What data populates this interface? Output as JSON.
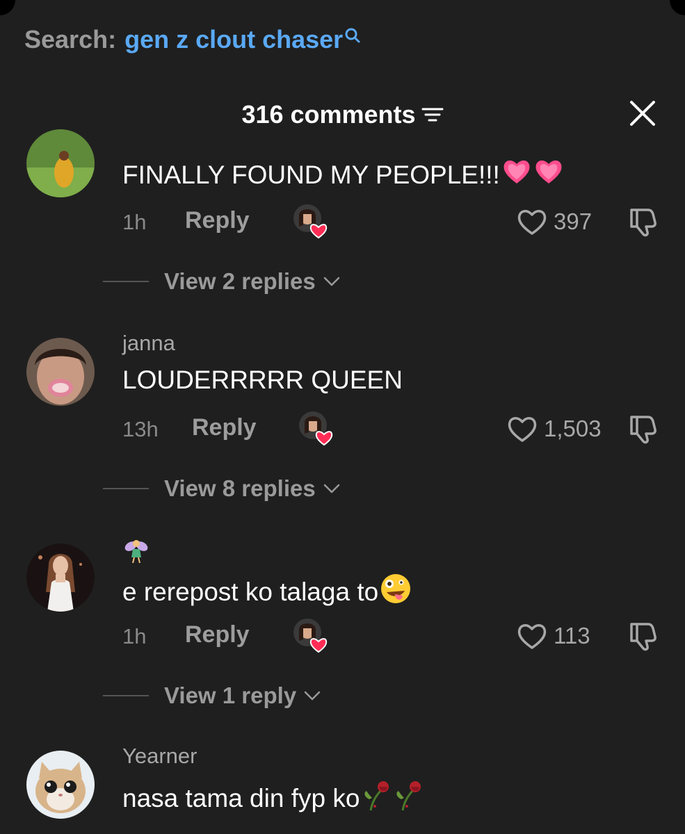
{
  "search": {
    "label": "Search:",
    "query": "gen z clout chaser"
  },
  "header": {
    "count_label": "316 comments"
  },
  "comments": [
    {
      "username": "",
      "text": "FINALLY FOUND MY PEOPLE!!!",
      "time": "1h",
      "reply_label": "Reply",
      "likes": "397",
      "view_replies": "View 2 replies"
    },
    {
      "username": "janna",
      "text": "LOUDERRRRR QUEEN",
      "time": "13h",
      "reply_label": "Reply",
      "likes": "1,503",
      "view_replies": "View 8 replies"
    },
    {
      "username": "🧚",
      "text": "e rerepost ko talaga to",
      "time": "1h",
      "reply_label": "Reply",
      "likes": "113",
      "view_replies": "View 1 reply"
    },
    {
      "username": "Yearner",
      "text": "nasa tama din fyp ko"
    }
  ],
  "colors": {
    "background": "#1f1f1f",
    "accent": "#5aa9f5",
    "heart_pink": "#ff4d8d"
  },
  "icons": [
    "search-icon",
    "filter-icon",
    "close-icon",
    "heart-outline-icon",
    "dislike-icon",
    "chevron-down-icon",
    "creator-liked-badge-icon",
    "pink-heart-emoji-icon",
    "fairy-emoji-icon",
    "zany-face-emoji-icon",
    "wilted-rose-emoji-icon"
  ]
}
